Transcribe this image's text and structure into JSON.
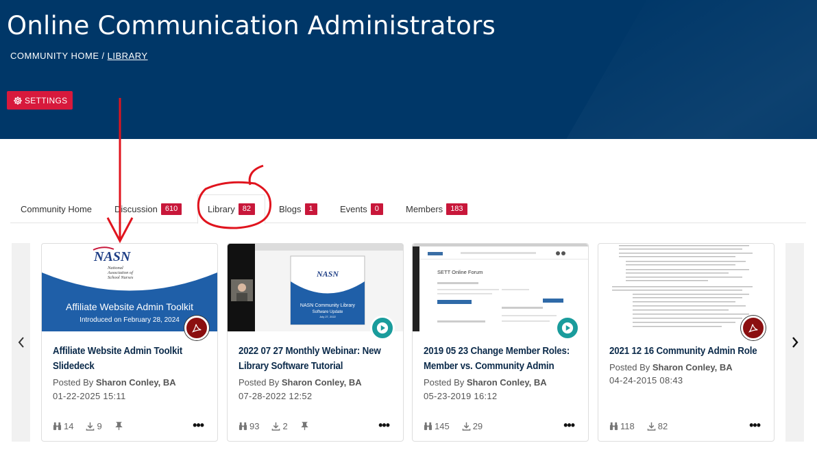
{
  "header": {
    "title": "Online Communication Administrators",
    "breadcrumb": {
      "home": "COMMUNITY HOME",
      "separator": "/",
      "current": "LIBRARY"
    },
    "settings_label": "SETTINGS"
  },
  "colors": {
    "header_bg": "#003768",
    "accent_red": "#d7193c",
    "card_title": "#0b2a4a"
  },
  "tabs": [
    {
      "label": "Community Home",
      "count": ""
    },
    {
      "label": "Discussion",
      "count": "610"
    },
    {
      "label": "Library",
      "count": "82"
    },
    {
      "label": "Blogs",
      "count": "1"
    },
    {
      "label": "Events",
      "count": "0"
    },
    {
      "label": "Members",
      "count": "183"
    }
  ],
  "cards": [
    {
      "title": "Affiliate Website Admin Toolkit Slidedeck",
      "posted_prefix": "Posted By",
      "author": "Sharon Conley, BA",
      "date": "01-22-2025 15:11",
      "views": "14",
      "downloads": "9",
      "type_icon": "pdf-icon",
      "thumb": {
        "logo": "NASN",
        "org_line1": "National",
        "org_line2": "Association of",
        "org_line3": "School Nurses",
        "heading": "Affiliate Website Admin Toolkit",
        "subheading": "Introduced on February 28, 2024"
      }
    },
    {
      "title": "2022 07 27 Monthly Webinar: New Library Software Tutorial",
      "posted_prefix": "Posted By",
      "author": "Sharon Conley, BA",
      "date": "07-28-2022 12:52",
      "views": "93",
      "downloads": "2",
      "type_icon": "play-icon",
      "thumb": {
        "logo": "NASN",
        "heading": "NASN Community Library",
        "subheading": "Software Update",
        "date": "July 27, 2022"
      }
    },
    {
      "title": "2019 05 23 Change Member Roles: Member vs. Community Admin",
      "posted_prefix": "Posted By",
      "author": "Sharon Conley, BA",
      "date": "05-23-2019 16:12",
      "views": "145",
      "downloads": "29",
      "type_icon": "play-icon",
      "thumb": {
        "heading": "SETT Online Forum"
      }
    },
    {
      "title": "2021 12 16 Community Admin Role",
      "posted_prefix": "Posted By",
      "author": "Sharon Conley, BA",
      "date": "04-24-2015 08:43",
      "views": "118",
      "downloads": "82",
      "type_icon": "pdf-icon"
    }
  ]
}
